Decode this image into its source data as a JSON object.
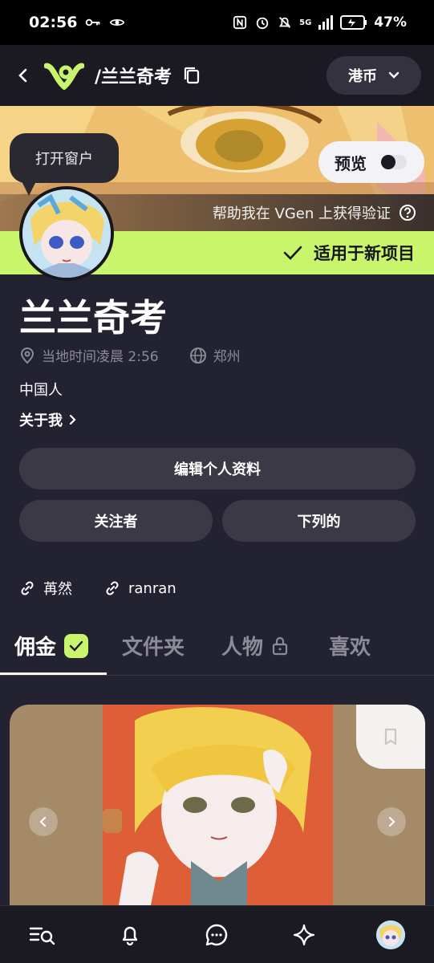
{
  "status_bar": {
    "time": "02:56",
    "battery": "47%",
    "network": "5G"
  },
  "header": {
    "username": "/兰兰奇考",
    "currency": "港币"
  },
  "banner": {
    "verify_text": "帮助我在 VGen 上获得验证",
    "preview_label": "预览",
    "tooltip": "打开窗户"
  },
  "availability": {
    "label": "适用于新项目"
  },
  "profile": {
    "display_name": "兰兰奇考",
    "local_time": "当地时间凌晨 2:56",
    "location": "郑州",
    "bio": "中国人",
    "about_label": "关于我"
  },
  "buttons": {
    "edit_profile": "编辑个人资料",
    "followers": "关注者",
    "following": "下列的"
  },
  "links": [
    {
      "label": "苒然"
    },
    {
      "label": "ranran"
    }
  ],
  "tabs": [
    {
      "label": "佣金"
    },
    {
      "label": "文件夹"
    },
    {
      "label": "人物"
    },
    {
      "label": "喜欢"
    }
  ],
  "colors": {
    "background": "#232230",
    "accent_green": "#c9f56c",
    "button_bg": "#3a3945"
  },
  "icons": {
    "back": "chevron-left-icon",
    "copy": "copy-icon",
    "help": "help-circle-icon",
    "location": "map-pin-icon",
    "globe": "globe-icon",
    "link": "link-icon",
    "lock": "lock-icon",
    "bookmark": "bookmark-icon"
  }
}
